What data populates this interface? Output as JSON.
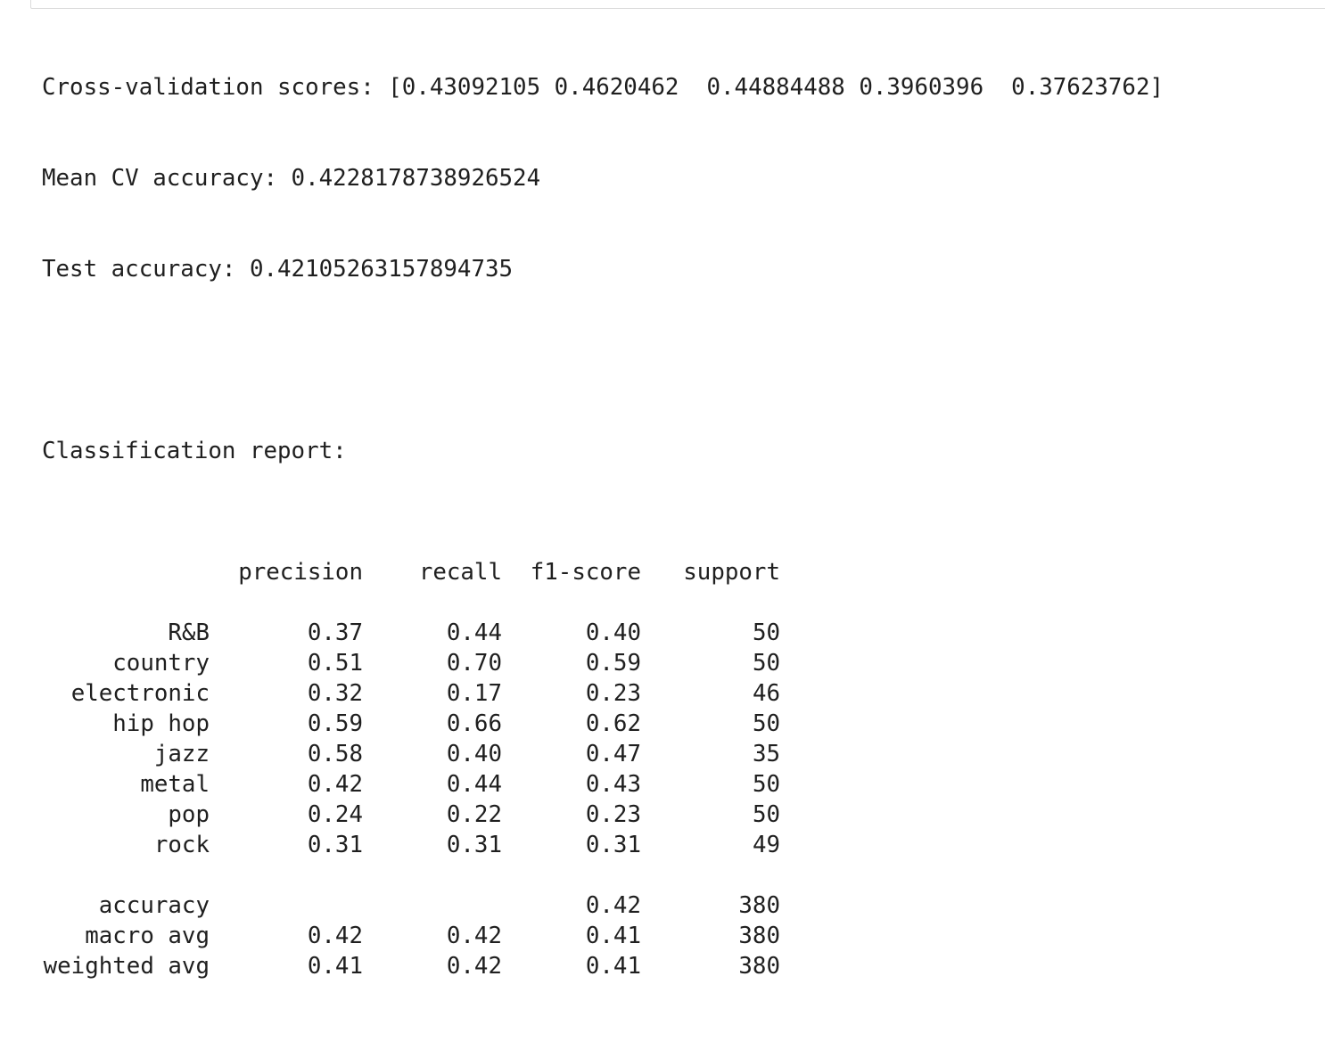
{
  "cv_scores_line": "Cross-validation scores: [0.43092105 0.4620462  0.44884488 0.3960396  0.37623762]",
  "mean_cv_line": "Mean CV accuracy: 0.4228178738926524",
  "test_accuracy_line": "Test accuracy: 0.42105263157894735",
  "report_title": "Classification report:",
  "report": {
    "columns": [
      "precision",
      "recall",
      "f1-score",
      "support"
    ],
    "classes": [
      {
        "label": "R&B",
        "precision": "0.37",
        "recall": "0.44",
        "f1": "0.40",
        "support": "50"
      },
      {
        "label": "country",
        "precision": "0.51",
        "recall": "0.70",
        "f1": "0.59",
        "support": "50"
      },
      {
        "label": "electronic",
        "precision": "0.32",
        "recall": "0.17",
        "f1": "0.23",
        "support": "46"
      },
      {
        "label": "hip hop",
        "precision": "0.59",
        "recall": "0.66",
        "f1": "0.62",
        "support": "50"
      },
      {
        "label": "jazz",
        "precision": "0.58",
        "recall": "0.40",
        "f1": "0.47",
        "support": "35"
      },
      {
        "label": "metal",
        "precision": "0.42",
        "recall": "0.44",
        "f1": "0.43",
        "support": "50"
      },
      {
        "label": "pop",
        "precision": "0.24",
        "recall": "0.22",
        "f1": "0.23",
        "support": "50"
      },
      {
        "label": "rock",
        "precision": "0.31",
        "recall": "0.31",
        "f1": "0.31",
        "support": "49"
      }
    ],
    "summary": [
      {
        "label": "accuracy",
        "precision": "",
        "recall": "",
        "f1": "0.42",
        "support": "380"
      },
      {
        "label": "macro avg",
        "precision": "0.42",
        "recall": "0.42",
        "f1": "0.41",
        "support": "380"
      },
      {
        "label": "weighted avg",
        "precision": "0.41",
        "recall": "0.42",
        "f1": "0.41",
        "support": "380"
      }
    ]
  }
}
